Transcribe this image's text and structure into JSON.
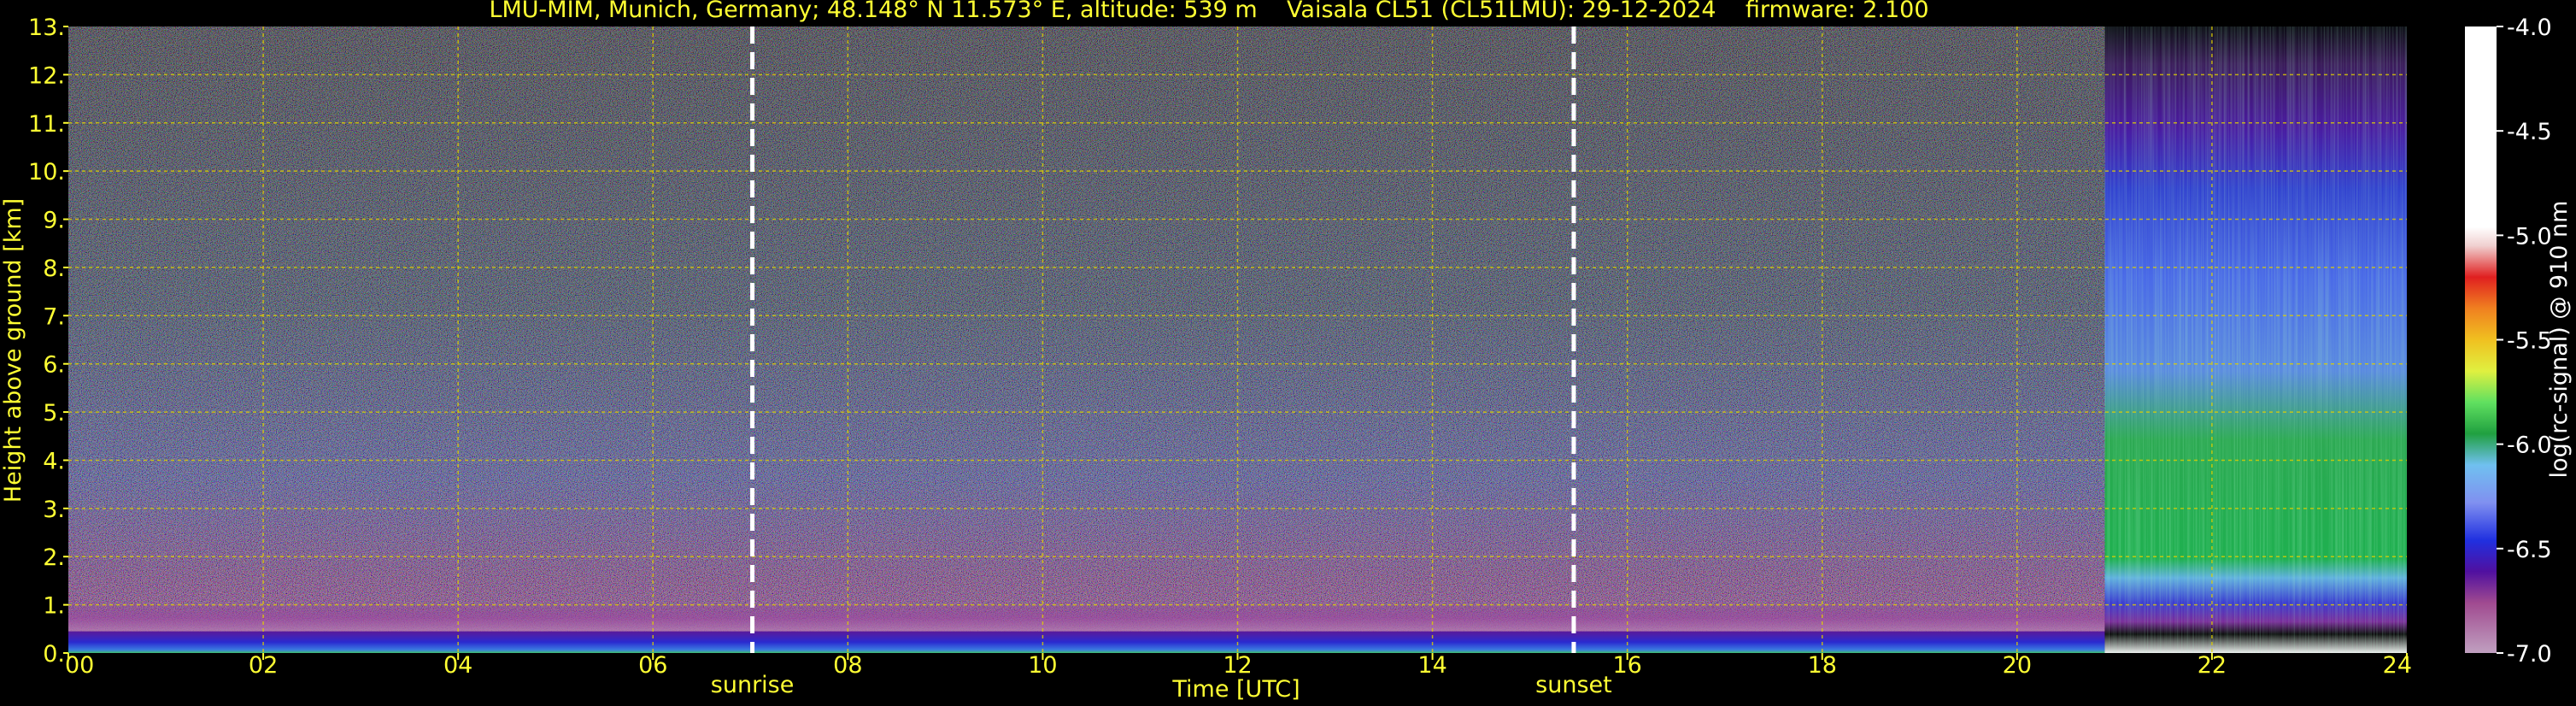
{
  "title": "LMU-MIM, Munich, Germany; 48.148° N 11.573° E, altitude: 539 m    Vaisala CL51 (CL51LMU): 29-12-2024    firmware: 2.100",
  "chart_data": {
    "type": "heatmap",
    "title": "LMU-MIM, Munich, Germany; 48.148° N 11.573° E, altitude: 539 m    Vaisala CL51 (CL51LMU): 29-12-2024    firmware: 2.100",
    "xlabel": "Time [UTC]",
    "ylabel": "Height above ground [km]",
    "xlim": [
      0,
      24
    ],
    "ylim": [
      0,
      13
    ],
    "x_ticks": [
      0,
      2,
      4,
      6,
      8,
      10,
      12,
      14,
      16,
      18,
      20,
      22,
      24
    ],
    "x_tick_labels": [
      "00",
      "02",
      "04",
      "06",
      "08",
      "10",
      "12",
      "14",
      "16",
      "18",
      "20",
      "22",
      "24"
    ],
    "y_ticks": [
      0,
      1,
      2,
      3,
      4,
      5,
      6,
      7,
      8,
      9,
      10,
      11,
      12,
      13
    ],
    "y_tick_labels": [
      "0.",
      "1.",
      "2.",
      "3.",
      "4.",
      "5.",
      "6.",
      "7.",
      "8.",
      "9.",
      "10.",
      "11.",
      "12.",
      "13."
    ],
    "grid": true,
    "markers": [
      {
        "label": "sunrise",
        "x": 7.02
      },
      {
        "label": "sunset",
        "x": 15.45
      }
    ],
    "colorbar": {
      "label": "log(rc-signal) @ 910 nm",
      "min": -7.0,
      "max": -4.0,
      "ticks": [
        -4.0,
        -4.5,
        -5.0,
        -5.5,
        -6.0,
        -6.5,
        -7.0
      ],
      "tick_labels": [
        "-4.0",
        "-4.5",
        "-5.0",
        "-5.5",
        "-6.0",
        "-6.5",
        "-7.0"
      ]
    },
    "regimes": [
      {
        "x_start": 0,
        "x_end": 20.9,
        "description_levels": {
          "surface_layer_top_km": 0.45,
          "boundary_layer_top_km": 1.0,
          "noise_top_km": 13
        }
      },
      {
        "x_start": 20.9,
        "x_end": 24,
        "description_levels": {
          "cloud_top_km": 4.5
        }
      }
    ]
  }
}
